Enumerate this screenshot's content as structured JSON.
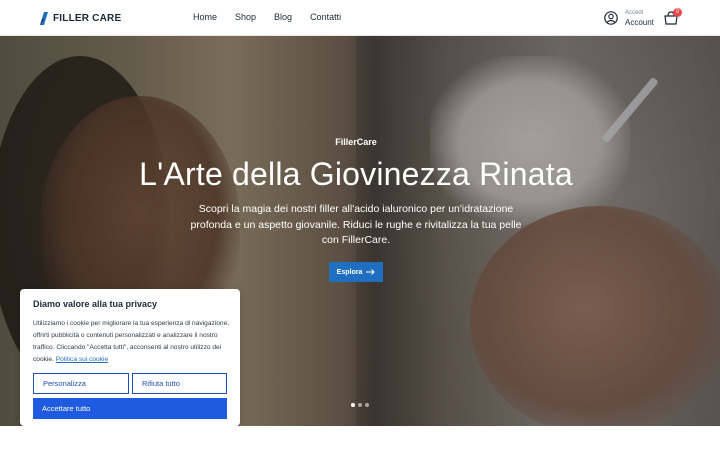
{
  "header": {
    "logo_text": "FILLER CARE",
    "nav": [
      "Home",
      "Shop",
      "Blog",
      "Contatti"
    ],
    "account_small": "Accedi",
    "account_big": "Account",
    "cart_count": "0",
    "brand_color": "#1f6fc1"
  },
  "hero": {
    "eyebrow": "FillerCare",
    "title": "L'Arte della Giovinezza Rinata",
    "text": "Scopri la magia dei nostri filler all'acido ialuronico per un'idratazione profonda e un aspetto giovanile. Riduci le rughe e rivitalizza la tua pelle con FillerCare.",
    "button_label": "Esplora",
    "slides_total": 3,
    "active_slide": 1
  },
  "cookie": {
    "title": "Diamo valore alla tua privacy",
    "text": "Utilizziamo i cookie per migliorare la tua esperienza di navigazione, offrirti pubblicità o contenuti personalizzati e analizzare il nostro traffico. Cliccando \"Accetta tutti\", acconsenti al nostro utilizzo dei cookie.",
    "link_label": "Politica sui cookie",
    "customize_label": "Personalizza",
    "reject_label": "Rifiuta tutto",
    "accept_label": "Accettare tutto",
    "accent_color": "#1f5be0"
  }
}
